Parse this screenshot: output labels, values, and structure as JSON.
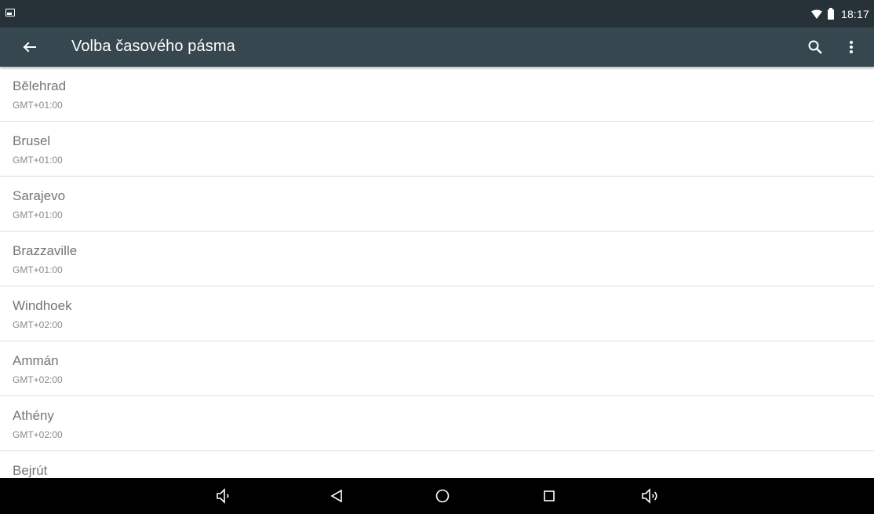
{
  "status_bar": {
    "time": "18:17",
    "icons": [
      "image-notification-icon",
      "wifi-icon",
      "battery-icon"
    ]
  },
  "app_bar": {
    "title": "Volba časového pásma",
    "icons": [
      "back-arrow-icon",
      "search-icon",
      "more-vert-icon"
    ]
  },
  "timezones": [
    {
      "name": "Bělehrad",
      "offset": "GMT+01:00"
    },
    {
      "name": "Brusel",
      "offset": "GMT+01:00"
    },
    {
      "name": "Sarajevo",
      "offset": "GMT+01:00"
    },
    {
      "name": "Brazzaville",
      "offset": "GMT+01:00"
    },
    {
      "name": "Windhoek",
      "offset": "GMT+02:00"
    },
    {
      "name": "Ammán",
      "offset": "GMT+02:00"
    },
    {
      "name": "Athény",
      "offset": "GMT+02:00"
    },
    {
      "name": "Bejrút",
      "offset": ""
    }
  ],
  "nav_bar": {
    "icons": [
      "volume-down-icon",
      "back-triangle-icon",
      "home-circle-icon",
      "recents-square-icon",
      "volume-up-icon"
    ]
  },
  "colors": {
    "status_bar": "#263238",
    "app_bar": "#37474f",
    "nav_bar": "#000000",
    "item_title": "#757575",
    "item_summary": "#8a8a8a",
    "divider": "#dcdcdc"
  }
}
